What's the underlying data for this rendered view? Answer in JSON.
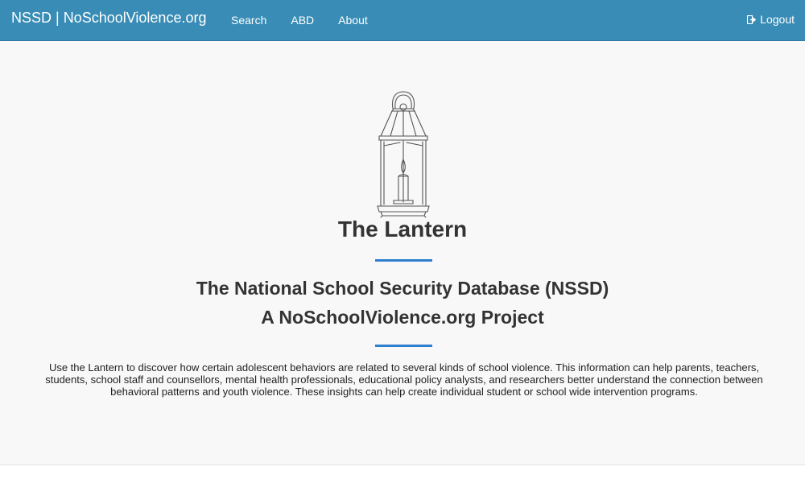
{
  "navbar": {
    "brand": "NSSD | NoSchoolViolence.org",
    "links": [
      {
        "label": "Search"
      },
      {
        "label": "ABD"
      },
      {
        "label": "About"
      }
    ],
    "logout_label": "Logout",
    "logout_icon": "logout-icon",
    "background_color": "#388cb5"
  },
  "hero": {
    "image": "lantern-illustration",
    "title": "The Lantern",
    "subtitle_line1": "The National School Security Database (NSSD)",
    "subtitle_line2": "A NoSchoolViolence.org Project",
    "description": "Use the Lantern to discover how certain adolescent behaviors are related to several kinds of school violence. This information can help parents, teachers, students, school staff and counsellors, mental health professionals, educational policy analysts, and researchers better understand the connection between behavioral patterns and youth violence. These insights can help create individual student or school wide intervention programs.",
    "accent_color": "#2f7fcf"
  }
}
